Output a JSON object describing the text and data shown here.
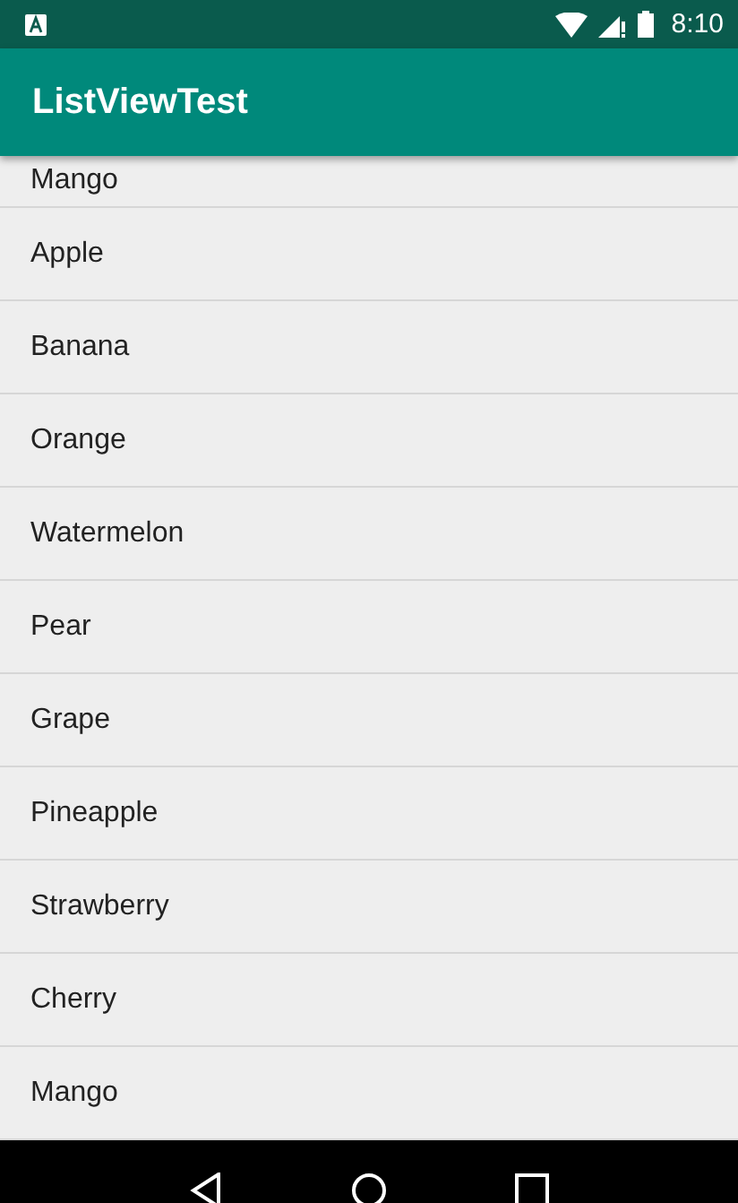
{
  "status_bar": {
    "time": "8:10"
  },
  "app_bar": {
    "title": "ListViewTest"
  },
  "list": {
    "items": [
      {
        "label": "Mango"
      },
      {
        "label": "Apple"
      },
      {
        "label": "Banana"
      },
      {
        "label": "Orange"
      },
      {
        "label": "Watermelon"
      },
      {
        "label": "Pear"
      },
      {
        "label": "Grape"
      },
      {
        "label": "Pineapple"
      },
      {
        "label": "Strawberry"
      },
      {
        "label": "Cherry"
      },
      {
        "label": "Mango"
      }
    ]
  }
}
